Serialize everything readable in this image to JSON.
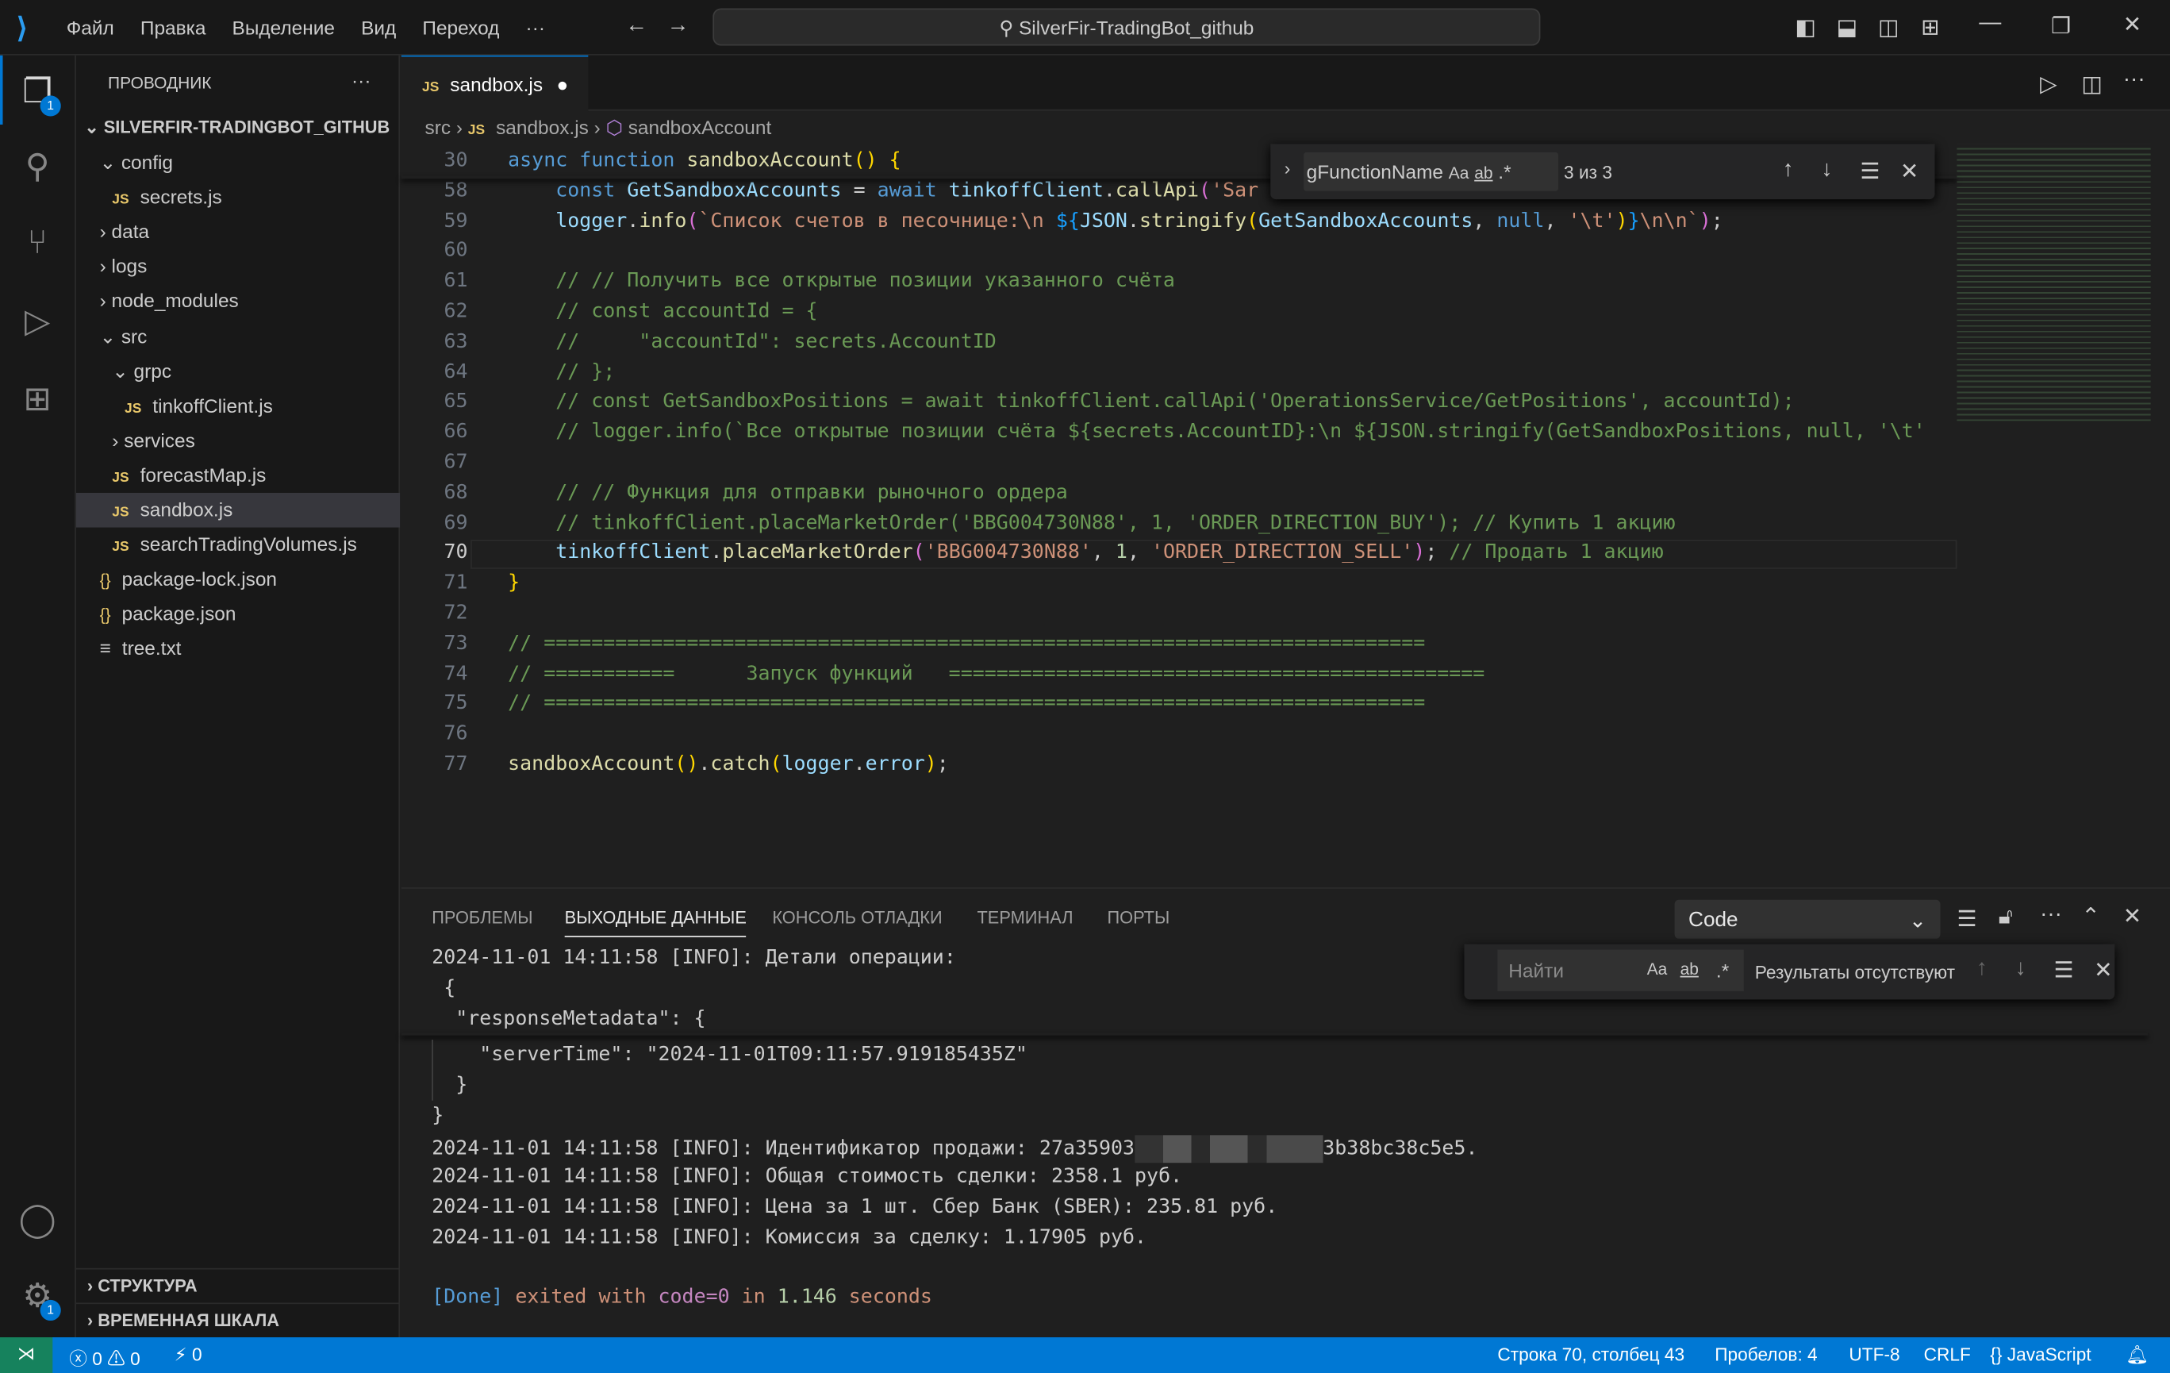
{
  "titlebar": {
    "menu": [
      "Файл",
      "Правка",
      "Выделение",
      "Вид",
      "Переход",
      "···"
    ],
    "search": "SilverFir-TradingBot_github"
  },
  "activity_badges": {
    "explorer": "1",
    "settings": "1"
  },
  "explorer": {
    "title": "ПРОВОДНИК",
    "more": "···",
    "root": "SILVERFIR-TRADINGBOT_GITHUB",
    "items": [
      {
        "label": "config",
        "kind": "folder-open",
        "depth": 1
      },
      {
        "label": "secrets.js",
        "kind": "js",
        "depth": 2
      },
      {
        "label": "data",
        "kind": "folder",
        "depth": 1
      },
      {
        "label": "logs",
        "kind": "folder",
        "depth": 1
      },
      {
        "label": "node_modules",
        "kind": "folder",
        "depth": 1
      },
      {
        "label": "src",
        "kind": "folder-open",
        "depth": 1
      },
      {
        "label": "grpc",
        "kind": "folder-open",
        "depth": 2
      },
      {
        "label": "tinkoffClient.js",
        "kind": "js",
        "depth": 3
      },
      {
        "label": "services",
        "kind": "folder",
        "depth": 2
      },
      {
        "label": "forecastMap.js",
        "kind": "js",
        "depth": 2
      },
      {
        "label": "sandbox.js",
        "kind": "js",
        "depth": 2,
        "selected": true
      },
      {
        "label": "searchTradingVolumes.js",
        "kind": "js",
        "depth": 2
      },
      {
        "label": "package-lock.json",
        "kind": "json",
        "depth": 1
      },
      {
        "label": "package.json",
        "kind": "json",
        "depth": 1
      },
      {
        "label": "tree.txt",
        "kind": "txt",
        "depth": 1
      }
    ],
    "sections": [
      "СТРУКТУРА",
      "ВРЕМЕННАЯ ШКАЛА"
    ]
  },
  "editor": {
    "tab": {
      "icon": "JS",
      "label": "sandbox.js",
      "modified": true
    },
    "breadcrumb": [
      "src",
      "sandbox.js",
      "sandboxAccount"
    ],
    "find": {
      "query": "gFunctionName",
      "case": "Aa",
      "word": "ab",
      "regex": ".*",
      "result": "3 из 3"
    },
    "current_line": 70,
    "lines": [
      {
        "n": "30",
        "t": [
          [
            "async ",
            "kw"
          ],
          [
            "function ",
            "kw"
          ],
          [
            "sandboxAccount",
            "fn"
          ],
          [
            "() ",
            "br1"
          ],
          [
            "{",
            "br1"
          ]
        ]
      },
      {
        "n": "58",
        "t": [
          [
            "    const ",
            "kw"
          ],
          [
            "GetSandboxAccounts",
            "id"
          ],
          [
            " = ",
            "tx"
          ],
          [
            "await ",
            "kw"
          ],
          [
            "tinkoffClient",
            "id"
          ],
          [
            ".",
            "tx"
          ],
          [
            "callApi",
            "fn"
          ],
          [
            "(",
            "br2"
          ],
          [
            "'Sar",
            "st"
          ]
        ]
      },
      {
        "n": "59",
        "t": [
          [
            "    logger",
            "id"
          ],
          [
            ".",
            "tx"
          ],
          [
            "info",
            "fn"
          ],
          [
            "(",
            "br2"
          ],
          [
            "`Список счетов в песочнице:\\n ",
            "st"
          ],
          [
            "${",
            "br3"
          ],
          [
            "JSON",
            "id"
          ],
          [
            ".",
            "tx"
          ],
          [
            "stringify",
            "fn"
          ],
          [
            "(",
            "br1"
          ],
          [
            "GetSandboxAccounts",
            "id"
          ],
          [
            ", ",
            "tx"
          ],
          [
            "null",
            "kw"
          ],
          [
            ", ",
            "tx"
          ],
          [
            "'\\t'",
            "st"
          ],
          [
            ")",
            "br1"
          ],
          [
            "}",
            "br3"
          ],
          [
            "\\n\\n`",
            "st"
          ],
          [
            ")",
            "br2"
          ],
          [
            ";",
            "tx"
          ]
        ]
      },
      {
        "n": "60",
        "t": []
      },
      {
        "n": "61",
        "t": [
          [
            "    // // Получить все открытые позиции указанного счёта",
            "cm"
          ]
        ]
      },
      {
        "n": "62",
        "t": [
          [
            "    // const accountId = {",
            "cm"
          ]
        ]
      },
      {
        "n": "63",
        "t": [
          [
            "    //     \"accountId\": secrets.AccountID",
            "cm"
          ]
        ]
      },
      {
        "n": "64",
        "t": [
          [
            "    // };",
            "cm"
          ]
        ]
      },
      {
        "n": "65",
        "t": [
          [
            "    // const GetSandboxPositions = await tinkoffClient.callApi('OperationsService/GetPositions', accountId);",
            "cm"
          ]
        ]
      },
      {
        "n": "66",
        "t": [
          [
            "    // logger.info(`Все открытые позиции счёта ${secrets.AccountID}:\\n ${JSON.stringify(GetSandboxPositions, null, '\\t'",
            "cm"
          ]
        ]
      },
      {
        "n": "67",
        "t": []
      },
      {
        "n": "68",
        "t": [
          [
            "    // // Функция для отправки рыночного ордера",
            "cm"
          ]
        ]
      },
      {
        "n": "69",
        "t": [
          [
            "    // tinkoffClient.placeMarketOrder('BBG004730N88', 1, 'ORDER_DIRECTION_BUY'); // Купить 1 акцию",
            "cm"
          ]
        ]
      },
      {
        "n": "70",
        "t": [
          [
            "    tinkoffClient",
            "id"
          ],
          [
            ".",
            "tx"
          ],
          [
            "placeMarketOrder",
            "fn"
          ],
          [
            "(",
            "br2"
          ],
          [
            "'BBG004730N88'",
            "st"
          ],
          [
            ", ",
            "tx"
          ],
          [
            "1",
            "nu"
          ],
          [
            ", ",
            "tx"
          ],
          [
            "'ORDER_DIRECTION_SELL'",
            "st"
          ],
          [
            ")",
            "br2"
          ],
          [
            "; ",
            "tx"
          ],
          [
            "// Продать 1 акцию",
            "cm"
          ]
        ]
      },
      {
        "n": "71",
        "t": [
          [
            "}",
            "br1"
          ]
        ]
      },
      {
        "n": "72",
        "t": []
      },
      {
        "n": "73",
        "t": [
          [
            "// ==========================================================================",
            "cm"
          ]
        ]
      },
      {
        "n": "74",
        "t": [
          [
            "// ===========      Запуск функций   =============================================",
            "cm"
          ]
        ]
      },
      {
        "n": "75",
        "t": [
          [
            "// ==========================================================================",
            "cm"
          ]
        ]
      },
      {
        "n": "76",
        "t": []
      },
      {
        "n": "77",
        "t": [
          [
            "sandboxAccount",
            "fn"
          ],
          [
            "()",
            "br1"
          ],
          [
            ".",
            "tx"
          ],
          [
            "catch",
            "fn"
          ],
          [
            "(",
            "br1"
          ],
          [
            "logger",
            "id"
          ],
          [
            ".",
            "tx"
          ],
          [
            "error",
            "id"
          ],
          [
            ")",
            "br1"
          ],
          [
            ";",
            "tx"
          ]
        ]
      }
    ]
  },
  "panel": {
    "tabs": [
      "ПРОБЛЕМЫ",
      "ВЫХОДНЫЕ ДАННЫЕ",
      "КОНСОЛЬ ОТЛАДКИ",
      "ТЕРМИНАЛ",
      "ПОРТЫ"
    ],
    "active_tab": 1,
    "channel": "Code",
    "find": {
      "placeholder": "Найти",
      "case": "Aa",
      "word": "ab",
      "regex": ".*",
      "result": "Результаты отсутствуют"
    },
    "output": [
      [
        [
          "2024-11-01 14:11:58 [INFO]: Детали операции:",
          "tx"
        ]
      ],
      [
        [
          " {",
          "tx"
        ]
      ],
      [
        [
          "  \"responseMetadata\": {",
          "tx"
        ]
      ],
      [
        [
          "    \"serverTime\": \"2024-11-01T09:11:57.919185435Z\"",
          "tx"
        ]
      ],
      [
        [
          "  }",
          "tx"
        ]
      ],
      [
        [
          "}",
          "tx"
        ]
      ],
      [
        [
          "2024-11-01 14:11:58 [INFO]: Идентификатор продажи: 27a35903",
          "tx"
        ],
        [
          "██████████████",
          "blur"
        ],
        [
          "3b38bc38c5e5.",
          "tx"
        ]
      ],
      [
        [
          "2024-11-01 14:11:58 [INFO]: Общая стоимость сделки: 2358.1 руб.",
          "tx"
        ]
      ],
      [
        [
          "2024-11-01 14:11:58 [INFO]: Цена за 1 шт. Сбер Банк (SBER): 235.81 руб.",
          "tx"
        ]
      ],
      [
        [
          "2024-11-01 14:11:58 [INFO]: Комиссия за сделку: 1.17905 руб.",
          "tx"
        ]
      ],
      [],
      [
        [
          "[Done] ",
          "kw"
        ],
        [
          "exited with ",
          "st"
        ],
        [
          "code=0",
          "pu"
        ],
        [
          " in ",
          "st"
        ],
        [
          "1.146",
          "nu"
        ],
        [
          " seconds",
          "st"
        ]
      ]
    ]
  },
  "statusbar": {
    "errors": "0",
    "warnings": "0",
    "ports": "0",
    "position": "Строка 70, столбец 43",
    "spaces": "Пробелов: 4",
    "encoding": "UTF-8",
    "eol": "CRLF",
    "language": "JavaScript"
  },
  "colors": {
    "accent": "#0078d4",
    "background": "#1f1f1f",
    "sidebar": "#181818"
  }
}
